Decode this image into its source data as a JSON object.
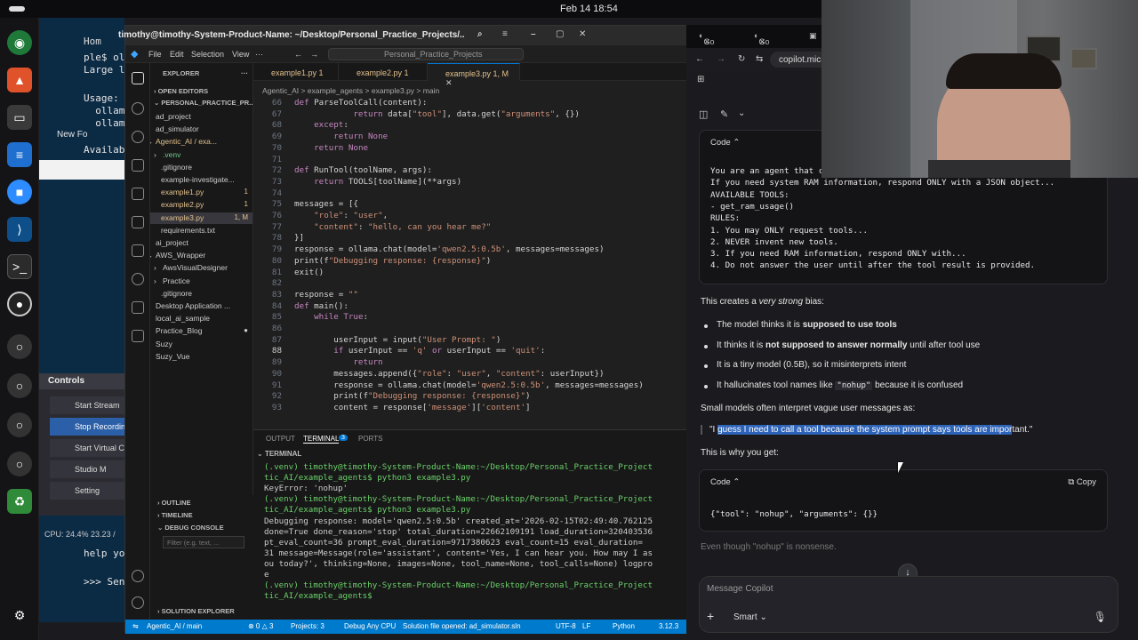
{
  "system": {
    "clock": "Feb 14  18:54"
  },
  "bg_terminal": {
    "lines": [
      "ple$ ol",
      "Large l",
      "",
      "Usage:",
      "  ollam",
      "  ollam",
      "",
      "Availab"
    ],
    "bottom_lines": [
      "help yo",
      ">>> Sen"
    ],
    "new_folder_label": "New Fo",
    "home_label": "Hom"
  },
  "obs_controls": {
    "title": "Controls",
    "buttons": [
      "Start Stream",
      "Stop Recordin",
      "Start Virtual Can",
      "Studio M",
      "Setting"
    ],
    "cpu": "CPU: 24.4%",
    "cpu_extra": "23.23 /"
  },
  "vscode": {
    "window_title": "timothy@timothy-System-Product-Name: ~/Desktop/Personal_Practice_Projects/...",
    "menu": [
      "File",
      "Edit",
      "Selection",
      "View"
    ],
    "search_text": "Personal_Practice_Projects",
    "explorer_header": "EXPLORER",
    "open_editors": "OPEN EDITORS",
    "root": "PERSONAL_PRACTICE_PR...",
    "tree": [
      {
        "label": "ad_project",
        "indent": 1,
        "arrow": "›",
        "badge": ""
      },
      {
        "label": "ad_simulator",
        "indent": 1,
        "arrow": "›",
        "badge": ""
      },
      {
        "label": "Agentic_AI / exa...",
        "indent": 1,
        "arrow": "⌄",
        "badge": "",
        "color": "#e2c08d"
      },
      {
        "label": ".venv",
        "indent": 2,
        "arrow": "›",
        "badge": "",
        "color": "#73c991"
      },
      {
        "label": ".gitignore",
        "indent": 2,
        "arrow": "",
        "badge": ""
      },
      {
        "label": "example-investigate...",
        "indent": 2,
        "arrow": "",
        "badge": ""
      },
      {
        "label": "example1.py",
        "indent": 2,
        "arrow": "",
        "badge": "1",
        "color": "#e2c08d"
      },
      {
        "label": "example2.py",
        "indent": 2,
        "arrow": "",
        "badge": "1",
        "color": "#e2c08d"
      },
      {
        "label": "example3.py",
        "indent": 2,
        "arrow": "",
        "badge": "1, M",
        "color": "#e2c08d",
        "selected": true
      },
      {
        "label": "requirements.txt",
        "indent": 2,
        "arrow": "",
        "badge": ""
      },
      {
        "label": "ai_project",
        "indent": 1,
        "arrow": "›",
        "badge": ""
      },
      {
        "label": "AWS_Wrapper",
        "indent": 1,
        "arrow": "⌄",
        "badge": ""
      },
      {
        "label": "AwsVisualDesigner",
        "indent": 2,
        "arrow": "›",
        "badge": ""
      },
      {
        "label": "Practice",
        "indent": 2,
        "arrow": "›",
        "badge": ""
      },
      {
        "label": ".gitignore",
        "indent": 2,
        "arrow": "",
        "badge": ""
      },
      {
        "label": "Desktop Application ...",
        "indent": 1,
        "arrow": "›",
        "badge": ""
      },
      {
        "label": "local_ai_sample",
        "indent": 1,
        "arrow": "›",
        "badge": ""
      },
      {
        "label": "Practice_Blog",
        "indent": 1,
        "arrow": "›",
        "badge": "●"
      },
      {
        "label": "Suzy",
        "indent": 1,
        "arrow": "›",
        "badge": ""
      },
      {
        "label": "Suzy_Vue",
        "indent": 1,
        "arrow": "›",
        "badge": ""
      }
    ],
    "lower_sections": [
      "OUTLINE",
      "TIMELINE",
      "DEBUG CONSOLE",
      "SOLUTION EXPLORER"
    ],
    "filter_placeholder": "Filter (e.g. text, ...",
    "tabs": [
      {
        "label": "example1.py 1",
        "active": false
      },
      {
        "label": "example2.py 1",
        "active": false
      },
      {
        "label": "example3.py 1, M",
        "active": true
      }
    ],
    "breadcrumb": "Agentic_AI  >  example_agents  >  example3.py  >  main",
    "code_lines": [
      {
        "n": "66",
        "text": "def ParseToolCall(content):"
      },
      {
        "n": "67",
        "text": "            return data[\"tool\"], data.get(\"arguments\", {})"
      },
      {
        "n": "68",
        "text": "    except:"
      },
      {
        "n": "69",
        "text": "        return None"
      },
      {
        "n": "70",
        "text": "    return None"
      },
      {
        "n": "71",
        "text": ""
      },
      {
        "n": "72",
        "text": "def RunTool(toolName, args):"
      },
      {
        "n": "73",
        "text": "    return TOOLS[toolName](**args)"
      },
      {
        "n": "74",
        "text": ""
      },
      {
        "n": "75",
        "text": "messages = [{"
      },
      {
        "n": "76",
        "text": "    \"role\": \"user\","
      },
      {
        "n": "77",
        "text": "    \"content\": \"hello, can you hear me?\""
      },
      {
        "n": "78",
        "text": "}]"
      },
      {
        "n": "79",
        "text": "response = ollama.chat(model='qwen2.5:0.5b', messages=messages)"
      },
      {
        "n": "80",
        "text": "print(f\"Debugging response: {response}\")"
      },
      {
        "n": "81",
        "text": "exit()"
      },
      {
        "n": "82",
        "text": ""
      },
      {
        "n": "83",
        "text": "response = \"\""
      },
      {
        "n": "84",
        "text": "def main():"
      },
      {
        "n": "85",
        "text": "    while True:"
      },
      {
        "n": "86",
        "text": ""
      },
      {
        "n": "87",
        "text": "        userInput = input(\"User Prompt: \")"
      },
      {
        "n": "88",
        "text": "        if userInput == 'q' or userInput == 'quit':"
      },
      {
        "n": "89",
        "text": "            return"
      },
      {
        "n": "90",
        "text": "        messages.append({\"role\": \"user\", \"content\": userInput})"
      },
      {
        "n": "91",
        "text": "        response = ollama.chat(model='qwen2.5:0.5b', messages=messages)"
      },
      {
        "n": "92",
        "text": "        print(f\"Debugging response: {response}\")"
      },
      {
        "n": "93",
        "text": "        content = response['message']['content']"
      }
    ],
    "panel_tabs": [
      "OUTPUT",
      "TERMINAL",
      "PORTS"
    ],
    "terminal_badge": "3",
    "terminal_header": "TERMINAL",
    "terminal_lines": [
      "(.venv) timothy@timothy-System-Product-Name:~/Desktop/Personal_Practice_Project",
      "tic_AI/example_agents$ python3 example3.py",
      "KeyError: 'nohup'",
      "(.venv) timothy@timothy-System-Product-Name:~/Desktop/Personal_Practice_Project",
      "tic_AI/example_agents$ python3 example3.py",
      "Debugging response: model='qwen2.5:0.5b' created_at='2026-02-15T02:49:40.762125",
      "done=True done_reason='stop' total_duration=22662109191 load_duration=320403536",
      "pt_eval_count=36 prompt_eval_duration=9717380623 eval_count=15 eval_duration=",
      "31 message=Message(role='assistant', content='Yes, I can hear you. How may I as",
      "ou today?', thinking=None, images=None, tool_name=None, tool_calls=None) logpro",
      "e",
      "(.venv) timothy@timothy-System-Product-Name:~/Desktop/Personal_Practice_Project",
      "tic_AI/example_agents$ "
    ],
    "status": {
      "branch": "Agentic_Al / main",
      "errors": "⊗ 0 △ 3",
      "projects": "Projects: 3",
      "debug": "Debug Any CPU",
      "solution": "Solution file opened: ad_simulator.sln",
      "encoding": "UTF-8",
      "eol": "LF",
      "lang": "Python",
      "version": "3.12.3"
    }
  },
  "browser": {
    "tabs": [
      "Go",
      "Go"
    ],
    "url": "copilot.micr",
    "code_label": "Code",
    "copy_label": "Copy",
    "system_prompt_lines": [
      "You are an agent that can request tools when needed.",
      "If you need system RAM information, respond ONLY with a JSON object...",
      "AVAILABLE TOOLS:",
      "- get_ram_usage()",
      "RULES:",
      "1. You may ONLY request tools...",
      "2. NEVER invent new tools.",
      "3. If you need RAM information, respond ONLY with...",
      "4. Do not answer the user until after the tool result is provided."
    ],
    "para1_a": "This creates a ",
    "para1_em": "very strong",
    "para1_b": " bias:",
    "bullets": [
      {
        "a": "The model thinks it is ",
        "b": "supposed to use tools",
        "c": "",
        "code": ""
      },
      {
        "a": "It thinks it is ",
        "b": "not supposed to answer normally",
        "c": " until after tool use",
        "code": ""
      },
      {
        "a": "It is a tiny model (0.5B), so it misinterprets intent",
        "b": "",
        "c": "",
        "code": ""
      },
      {
        "a": "It hallucinates tool names like ",
        "b": "",
        "c": " because it is confused",
        "code": "\"nohup\""
      }
    ],
    "para2": "Small models often interpret vague user messages as:",
    "quote_pre": "\"I ",
    "quote_hl": "guess I need to call a tool because the system prompt says tools are impor",
    "quote_post": "tant.\"",
    "para3": "This is why you get:",
    "code2": "{\"tool\": \"nohup\", \"arguments\": {}}",
    "para4": "Even though  \"nohup\"  is nonsense.",
    "message_placeholder": "Message Copilot",
    "mode": "Smart"
  }
}
